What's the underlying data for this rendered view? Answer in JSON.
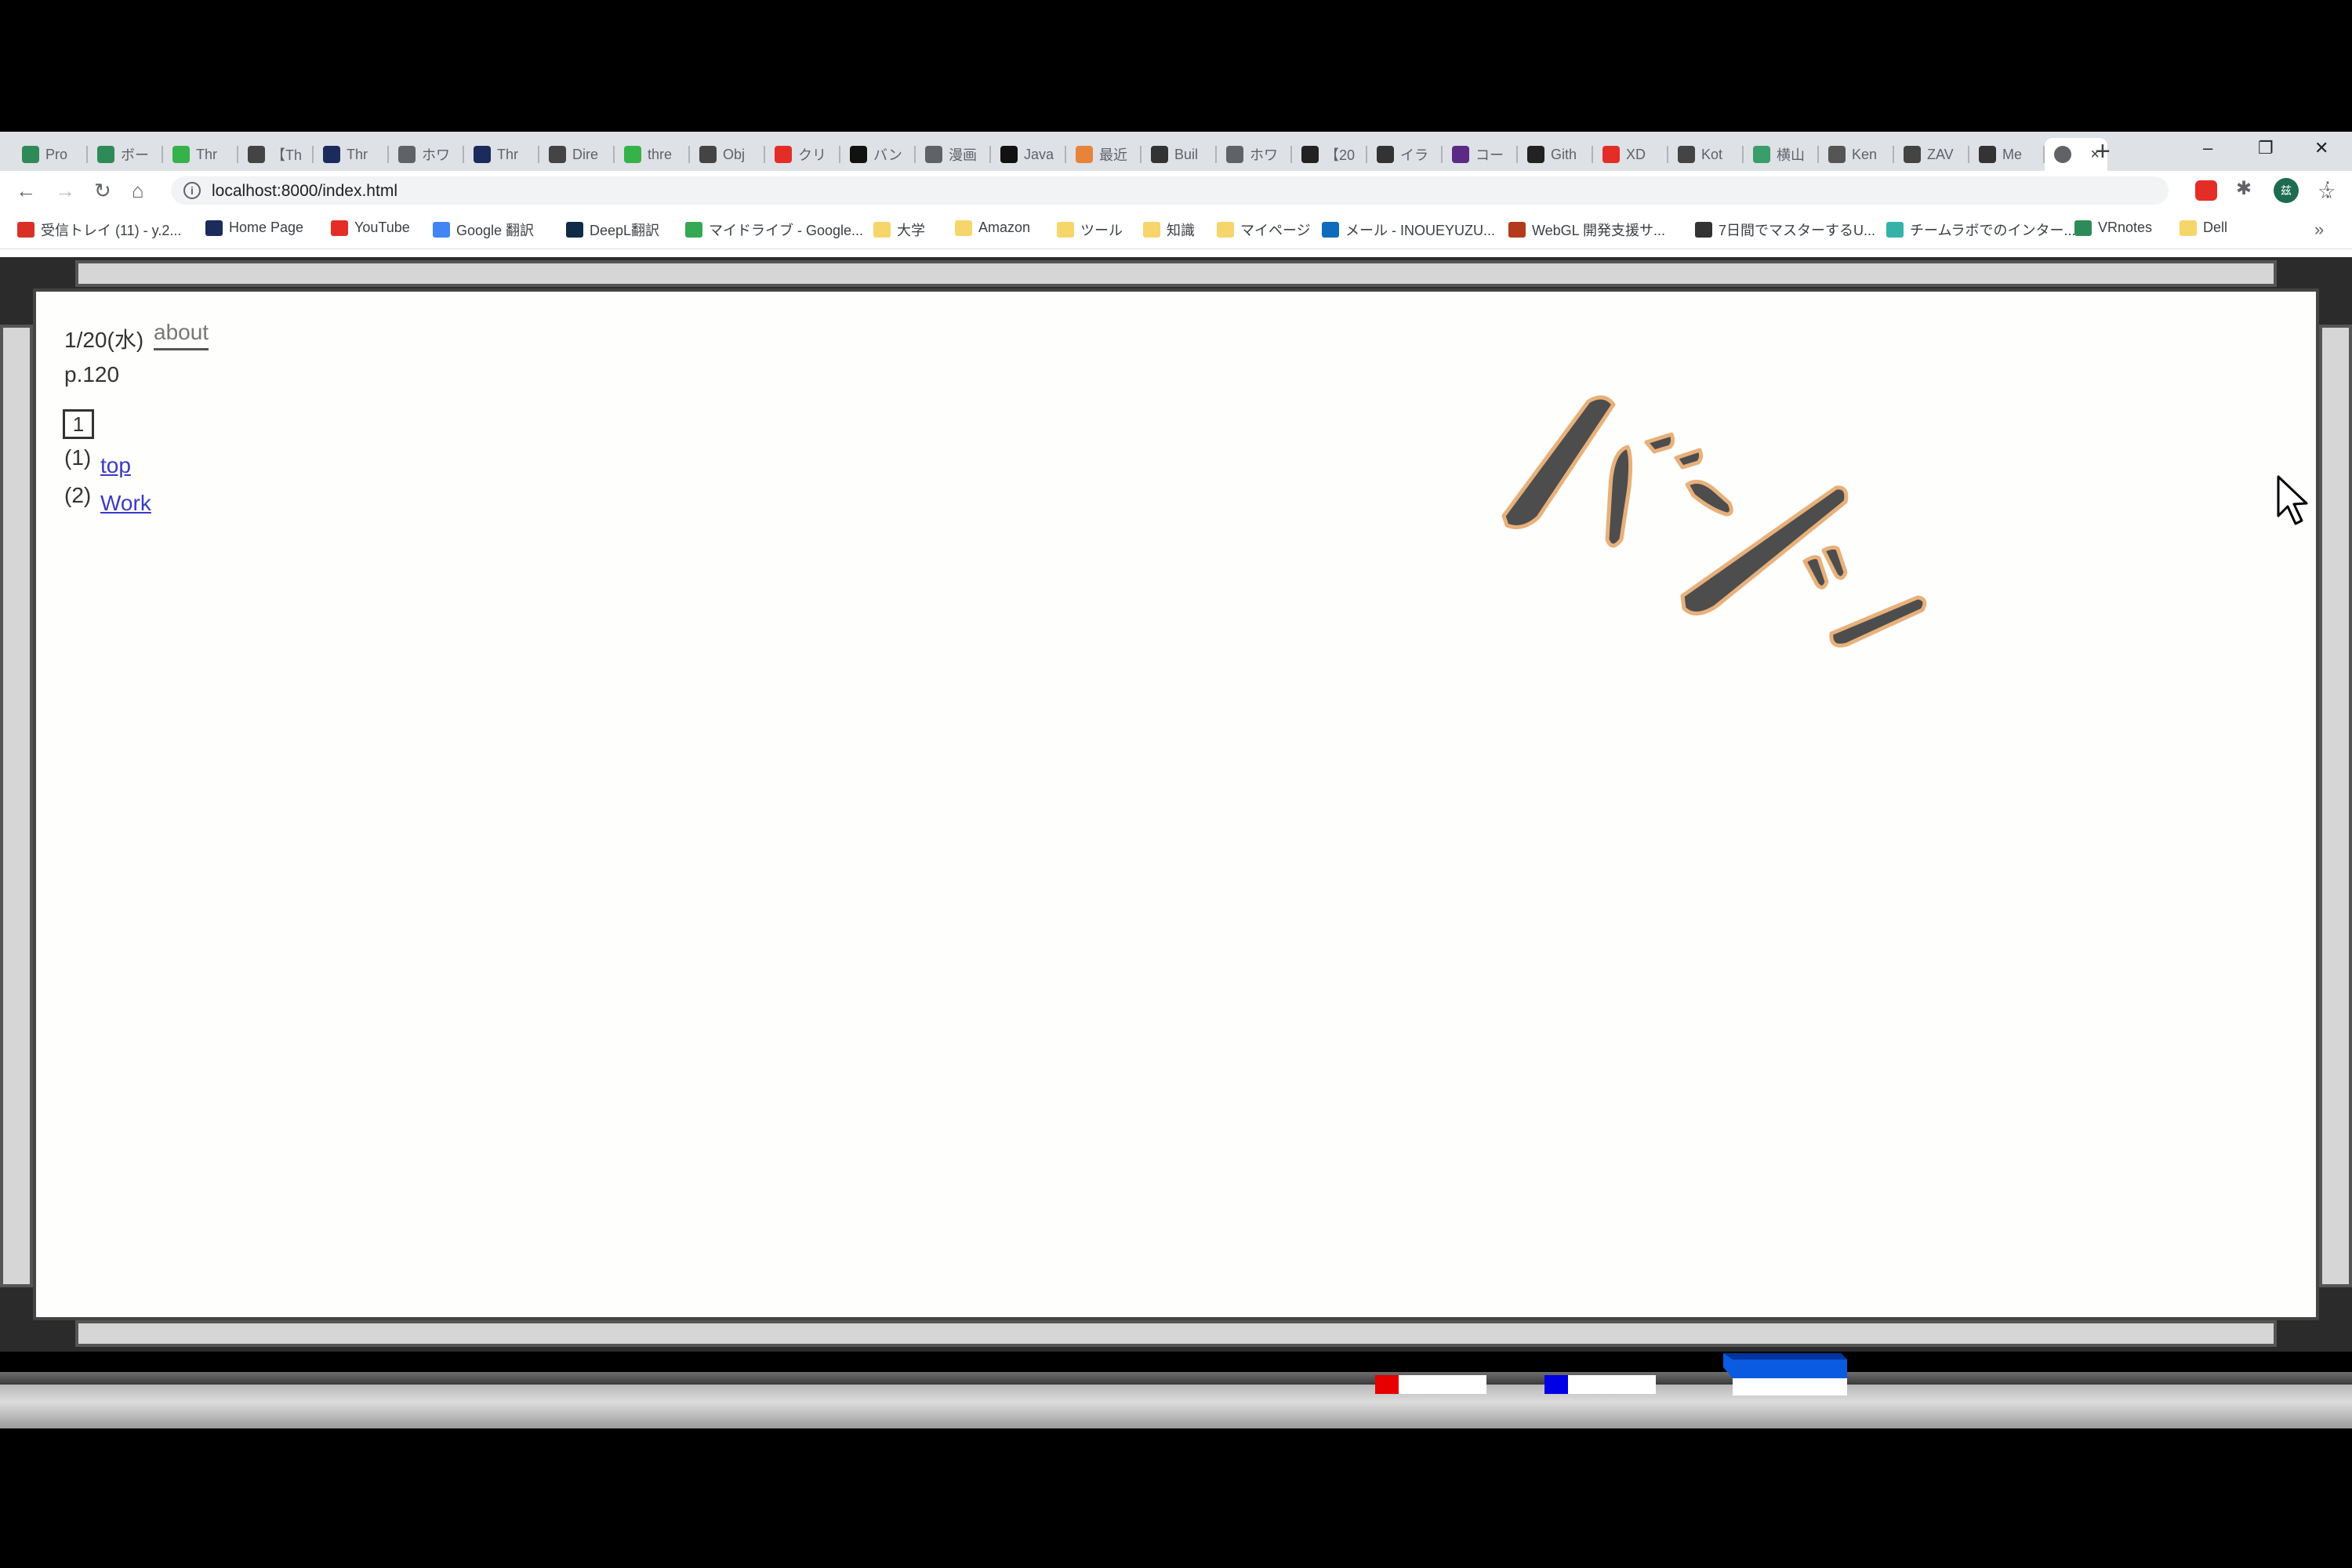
{
  "tabs": [
    {
      "label": "Pro",
      "icon": "vrnotes-icon",
      "color": "#2e8b57"
    },
    {
      "label": "ボー",
      "icon": "vrnotes-icon",
      "color": "#2e8b57"
    },
    {
      "label": "Thr",
      "icon": "green-circle-icon",
      "color": "#36b24a"
    },
    {
      "label": "【Th",
      "icon": "atlas-icon",
      "color": "#444"
    },
    {
      "label": "Thr",
      "icon": "threejs-icon",
      "color": "#1a2b5c"
    },
    {
      "label": "ホワ",
      "icon": "google-icon",
      "color": "#5f6368"
    },
    {
      "label": "Thr",
      "icon": "threejs-icon",
      "color": "#1a2b5c"
    },
    {
      "label": "Dire",
      "icon": "triangle-icon",
      "color": "#444"
    },
    {
      "label": "thre",
      "icon": "green-circle-icon",
      "color": "#36b24a"
    },
    {
      "label": "Obj",
      "icon": "triangle-icon",
      "color": "#444"
    },
    {
      "label": "クリ",
      "icon": "youtube-icon",
      "color": "#e52d27"
    },
    {
      "label": "バン",
      "icon": "f-icon",
      "color": "#111"
    },
    {
      "label": "漫画",
      "icon": "google-icon",
      "color": "#5f6368"
    },
    {
      "label": "Java",
      "icon": "a-icon",
      "color": "#111"
    },
    {
      "label": "最近",
      "icon": "moon-icon",
      "color": "#e8833a"
    },
    {
      "label": "Buil",
      "icon": "b-icon",
      "color": "#333"
    },
    {
      "label": "ホワ",
      "icon": "google-icon",
      "color": "#5f6368"
    },
    {
      "label": "【20",
      "icon": "w-icon",
      "color": "#222"
    },
    {
      "label": "イラ",
      "icon": "pixiv-icon",
      "color": "#333"
    },
    {
      "label": "コー",
      "icon": "p-icon",
      "color": "#5b2a86"
    },
    {
      "label": "Gith",
      "icon": "github-icon",
      "color": "#222"
    },
    {
      "label": "XD",
      "icon": "youtube-icon",
      "color": "#e52d27"
    },
    {
      "label": "Kot",
      "icon": "cloud-icon",
      "color": "#444"
    },
    {
      "label": "横山",
      "icon": "v-icon",
      "color": "#3a9e6a"
    },
    {
      "label": "Ken",
      "icon": "person-icon",
      "color": "#555"
    },
    {
      "label": "ZAV",
      "icon": "zav-icon",
      "color": "#444"
    },
    {
      "label": "Me",
      "icon": "x-logo-icon",
      "color": "#333"
    }
  ],
  "active_tab_close": "×",
  "new_tab": "+",
  "window_controls": {
    "minimize": "–",
    "restore": "❐",
    "close": "✕"
  },
  "url": "localhost:8000/index.html",
  "bookmarks": [
    {
      "label": "受信トレイ (11) - y.2...",
      "icon": "gmail-icon",
      "color": "#d93025"
    },
    {
      "label": "Home Page",
      "icon": "checkbox-icon",
      "color": "#1a2b5c"
    },
    {
      "label": "YouTube",
      "icon": "youtube-icon",
      "color": "#e52d27"
    },
    {
      "label": "Google 翻訳",
      "icon": "translate-icon",
      "color": "#4285f4"
    },
    {
      "label": "DeepL翻訳",
      "icon": "deepl-icon",
      "color": "#0f2b46"
    },
    {
      "label": "マイドライブ - Google...",
      "icon": "drive-icon",
      "color": "#34a853"
    },
    {
      "label": "大学",
      "icon": "folder-icon",
      "color": "#f6d56b"
    },
    {
      "label": "Amazon",
      "icon": "folder-icon",
      "color": "#f6d56b"
    },
    {
      "label": "ツール",
      "icon": "folder-icon",
      "color": "#f6d56b"
    },
    {
      "label": "知識",
      "icon": "folder-icon",
      "color": "#f6d56b"
    },
    {
      "label": "マイページ",
      "icon": "folder-icon",
      "color": "#f6d56b"
    },
    {
      "label": "メール - INOUEYUZU...",
      "icon": "outlook-icon",
      "color": "#0f6cbd"
    },
    {
      "label": "WebGL 開発支援サ...",
      "icon": "webgl-icon",
      "color": "#b33a1a"
    },
    {
      "label": "7日間でマスターするU...",
      "icon": "globe-icon",
      "color": "#333"
    },
    {
      "label": "チームラボでのインター...",
      "icon": "teamlab-icon",
      "color": "#35b3a8"
    },
    {
      "label": "VRnotes",
      "icon": "vrnotes-icon",
      "color": "#2e8b57"
    },
    {
      "label": "Dell",
      "icon": "folder-icon",
      "color": "#f6d56b"
    }
  ],
  "bookmarks_more": "»",
  "avatar_text": "兹",
  "page": {
    "date": "1/20(水)",
    "about": "about",
    "page_number": "p.120",
    "box_label": "1",
    "items": [
      {
        "num": "(1)",
        "link": "top"
      },
      {
        "num": "(2)",
        "link": "Work"
      }
    ]
  },
  "colors": {
    "sfx_fill": "#4d4d4d",
    "sfx_outline": "#e8b07a",
    "red_indicator": "#e60000",
    "blue_indicator": "#0000e6",
    "blue_block": "#0a5be0"
  }
}
